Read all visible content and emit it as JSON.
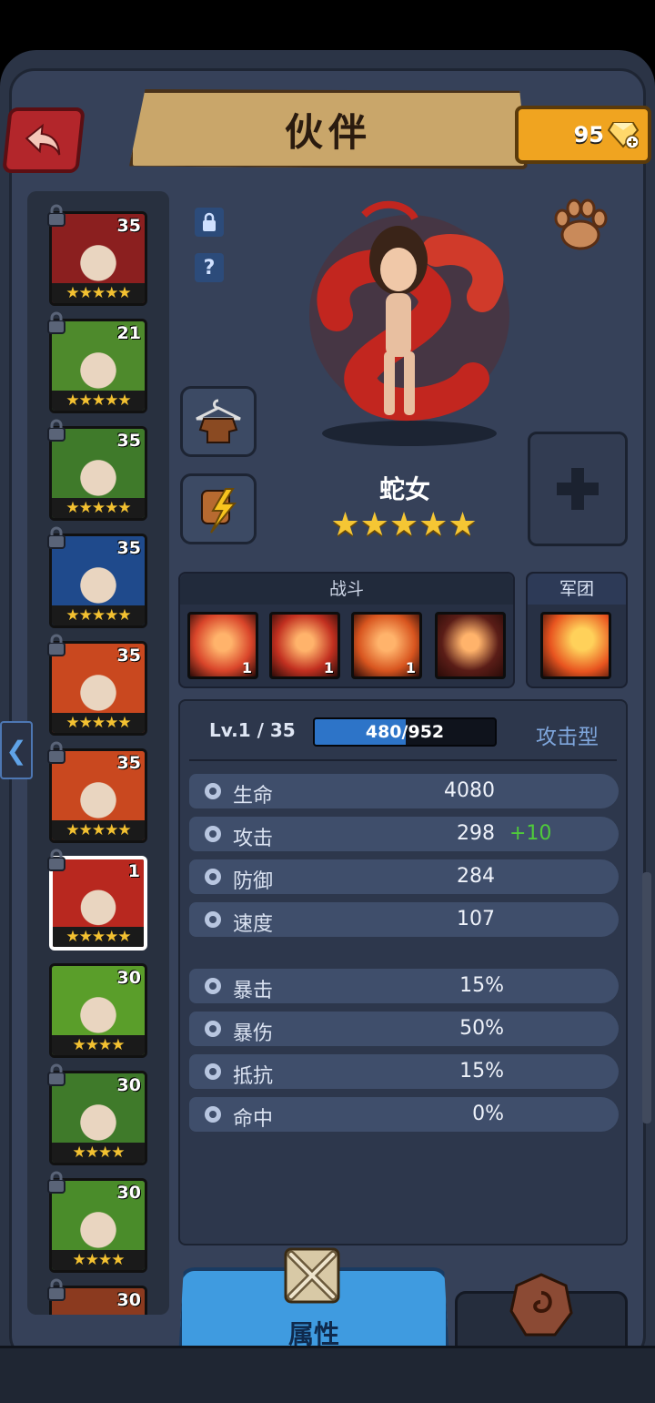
{
  "header": {
    "title": "伙伴",
    "gems": "95"
  },
  "roster": [
    {
      "level": "35",
      "stars": "★★★★★",
      "stars_count": 5,
      "locked": true,
      "palette": "#8b1f1f"
    },
    {
      "level": "21",
      "stars": "★★★★★",
      "stars_count": 5,
      "locked": true,
      "palette": "#4e8a2c"
    },
    {
      "level": "35",
      "stars": "★★★★★",
      "stars_count": 5,
      "locked": true,
      "palette": "#3f7a2a"
    },
    {
      "level": "35",
      "stars": "★★★★★",
      "stars_count": 5,
      "locked": true,
      "palette": "#1f4a8c"
    },
    {
      "level": "35",
      "stars": "★★★★★",
      "stars_count": 5,
      "locked": true,
      "palette": "#c9481f"
    },
    {
      "level": "35",
      "stars": "★★★★★",
      "stars_count": 5,
      "locked": true,
      "palette": "#c9481f"
    },
    {
      "level": "1",
      "stars": "★★★★★",
      "stars_count": 5,
      "locked": true,
      "palette": "#b8281f",
      "selected": true
    },
    {
      "level": "30",
      "stars": "★★★★",
      "stars_count": 4,
      "locked": false,
      "palette": "#5a9e2a"
    },
    {
      "level": "30",
      "stars": "★★★★",
      "stars_count": 4,
      "locked": true,
      "palette": "#3f7a2a"
    },
    {
      "level": "30",
      "stars": "★★★★",
      "stars_count": 4,
      "locked": true,
      "palette": "#4a8c2a"
    },
    {
      "level": "30",
      "stars": "",
      "stars_count": 0,
      "locked": true,
      "palette": "#8b3a1f"
    }
  ],
  "hero": {
    "name": "蛇女",
    "stars": "★★★★★",
    "question_mark": "?"
  },
  "skills": {
    "battle_header": "战斗",
    "legion_header": "军团",
    "battle": [
      {
        "count": "1",
        "icon": "snake-woman-skill-icon",
        "color": "#d9452a"
      },
      {
        "count": "1",
        "icon": "snake-strike-skill-icon",
        "color": "#c23020"
      },
      {
        "count": "1",
        "icon": "skull-flame-skill-icon",
        "color": "#d8551f"
      },
      {
        "count": "",
        "icon": "sword-locked-skill-icon",
        "color": "#5a1d17"
      }
    ],
    "legion": [
      {
        "icon": "fire-legion-skill-icon",
        "color": "#e8541f"
      }
    ]
  },
  "stats": {
    "level_text": "Lv.1 / 35",
    "xp_text_current": "480",
    "xp_text_max": "/952",
    "xp_fraction": 0.504,
    "type": "攻击型",
    "rows": [
      {
        "name": "生命",
        "value": "4080",
        "bonus": "",
        "icon": "heart-icon"
      },
      {
        "name": "攻击",
        "value": "298",
        "bonus": "+10",
        "icon": "attack-icon"
      },
      {
        "name": "防御",
        "value": "284",
        "bonus": "",
        "icon": "shield-icon"
      },
      {
        "name": "速度",
        "value": "107",
        "bonus": "",
        "icon": "speed-icon"
      },
      {
        "name": "暴击",
        "value": "15%",
        "bonus": "",
        "icon": "crit-icon"
      },
      {
        "name": "暴伤",
        "value": "50%",
        "bonus": "",
        "icon": "crit-damage-icon"
      },
      {
        "name": "抵抗",
        "value": "15%",
        "bonus": "",
        "icon": "resist-icon"
      },
      {
        "name": "命中",
        "value": "0%",
        "bonus": "",
        "icon": "accuracy-icon"
      }
    ]
  },
  "tabs": {
    "attributes_label": "属性"
  },
  "colors": {
    "accent_blue": "#3f9be0",
    "gold": "#f0a420",
    "star": "#f5c634",
    "bonus_green": "#4fcb3a"
  }
}
